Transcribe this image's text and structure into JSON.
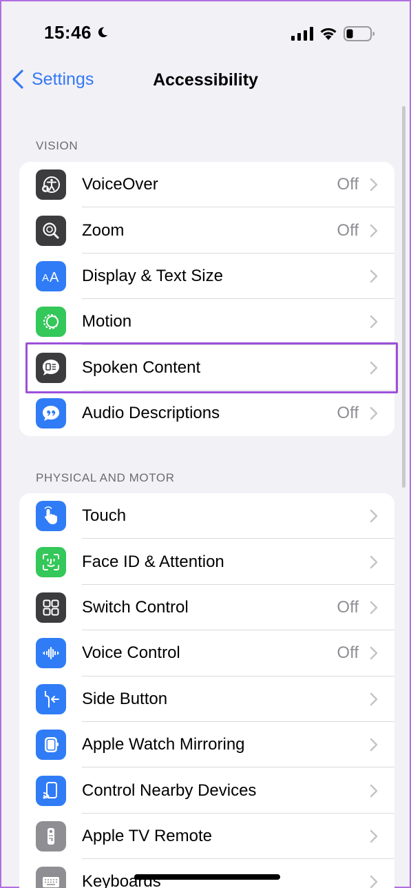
{
  "status": {
    "time": "15:46"
  },
  "nav": {
    "back_label": "Settings",
    "title": "Accessibility"
  },
  "sections": [
    {
      "header": "VISION",
      "items": [
        {
          "label": "VoiceOver",
          "value": "Off",
          "icon": "voiceover-icon",
          "color": "#3c3c3e"
        },
        {
          "label": "Zoom",
          "value": "Off",
          "icon": "zoom-icon",
          "color": "#3c3c3e"
        },
        {
          "label": "Display & Text Size",
          "value": "",
          "icon": "display-text-size-icon",
          "color": "#2f7cf6"
        },
        {
          "label": "Motion",
          "value": "",
          "icon": "motion-icon",
          "color": "#34c759"
        },
        {
          "label": "Spoken Content",
          "value": "",
          "icon": "spoken-content-icon",
          "color": "#3c3c3e"
        },
        {
          "label": "Audio Descriptions",
          "value": "Off",
          "icon": "audio-descriptions-icon",
          "color": "#2f7cf6"
        }
      ]
    },
    {
      "header": "PHYSICAL AND MOTOR",
      "items": [
        {
          "label": "Touch",
          "value": "",
          "icon": "touch-icon",
          "color": "#2f7cf6"
        },
        {
          "label": "Face ID & Attention",
          "value": "",
          "icon": "face-id-icon",
          "color": "#34c759"
        },
        {
          "label": "Switch Control",
          "value": "Off",
          "icon": "switch-control-icon",
          "color": "#3c3c3e"
        },
        {
          "label": "Voice Control",
          "value": "Off",
          "icon": "voice-control-icon",
          "color": "#2f7cf6"
        },
        {
          "label": "Side Button",
          "value": "",
          "icon": "side-button-icon",
          "color": "#2f7cf6"
        },
        {
          "label": "Apple Watch Mirroring",
          "value": "",
          "icon": "apple-watch-icon",
          "color": "#2f7cf6"
        },
        {
          "label": "Control Nearby Devices",
          "value": "",
          "icon": "nearby-devices-icon",
          "color": "#2f7cf6"
        },
        {
          "label": "Apple TV Remote",
          "value": "",
          "icon": "tv-remote-icon",
          "color": "#8e8e93"
        },
        {
          "label": "Keyboards",
          "value": "",
          "icon": "keyboard-icon",
          "color": "#8e8e93"
        }
      ]
    }
  ],
  "highlighted_item": "Spoken Content"
}
